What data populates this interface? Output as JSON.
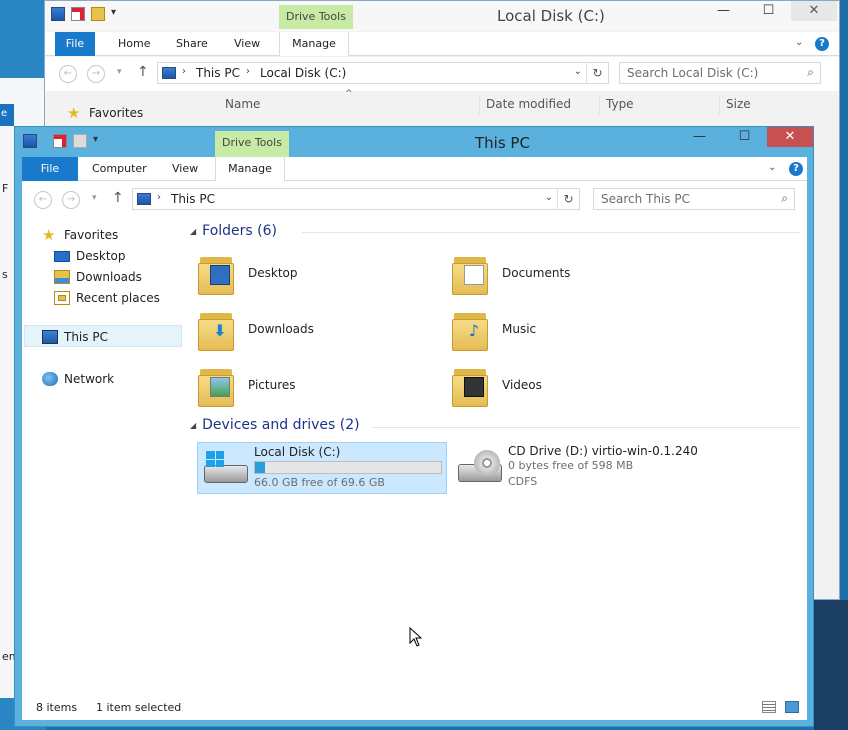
{
  "desktop": {
    "fragments": [
      "e",
      "F",
      "s",
      "em"
    ]
  },
  "background_window": {
    "title": "Local Disk (C:)",
    "drive_tools_label": "Drive Tools",
    "ribbon_tabs": [
      "File",
      "Home",
      "Share",
      "View",
      "Manage"
    ],
    "address": {
      "root": "This PC",
      "current": "Local Disk (C:)"
    },
    "search_placeholder": "Search Local Disk (C:)",
    "favorites_label": "Favorites",
    "columns": [
      "Name",
      "Date modified",
      "Type",
      "Size"
    ],
    "window_buttons": {
      "minimize": "—",
      "maximize": "☐",
      "close": "✕"
    }
  },
  "main_window": {
    "title": "This PC",
    "drive_tools_label": "Drive Tools",
    "ribbon_tabs": [
      "File",
      "Computer",
      "View",
      "Manage"
    ],
    "address": {
      "current": "This PC"
    },
    "search_placeholder": "Search This PC",
    "window_buttons": {
      "minimize": "—",
      "maximize": "☐",
      "close": "✕"
    },
    "nav": {
      "favorites": "Favorites",
      "desktop": "Desktop",
      "downloads": "Downloads",
      "recent": "Recent places",
      "thispc": "This PC",
      "network": "Network"
    },
    "folders_header": "Folders (6)",
    "folders": [
      "Desktop",
      "Documents",
      "Downloads",
      "Music",
      "Pictures",
      "Videos"
    ],
    "devices_header": "Devices and drives (2)",
    "drives": [
      {
        "name": "Local Disk (C:)",
        "free": "66.0 GB free of 69.6 GB",
        "used_fraction": 0.052
      },
      {
        "name": "CD Drive (D:) virtio-win-0.1.240",
        "free": "0 bytes free of 598 MB",
        "fs": "CDFS"
      }
    ],
    "status": {
      "items": "8 items",
      "selected": "1 item selected"
    }
  },
  "colors": {
    "accent": "#1979ca",
    "drive_tools": "#c7eaa4",
    "title_blue": "#5ab1dd",
    "close": "#c75050"
  }
}
